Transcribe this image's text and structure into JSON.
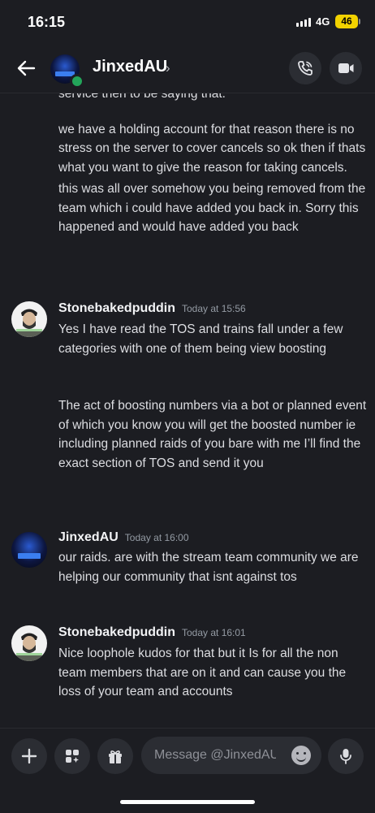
{
  "status": {
    "time": "16:15",
    "network": "4G",
    "battery": "46"
  },
  "header": {
    "title": "JinxedAU",
    "chevron": "›"
  },
  "messages": [
    {
      "lines": [
        "service then to be saying that.",
        "we have a holding account for that reason there is no stress on the server to cover cancels so ok then if thats what you want to give the reason for taking cancels.",
        "this was all over somehow you being removed from the team which i could have added you back in. Sorry this happened and would have added you back"
      ]
    },
    {
      "author": "Stonebakedpuddin",
      "time": "Today at 15:56",
      "lines": [
        "Yes I have read  the TOS and trains fall under a few categories with one of them being view boosting",
        "The act of boosting numbers via a bot or planned event of which you know you will get the boosted number ie including planned raids of you bare with me I’ll find the exact section of TOS and send it you"
      ]
    },
    {
      "author": "JinxedAU",
      "time": "Today at 16:00",
      "lines": [
        "our raids. are with the stream team community we are helping our community that isnt against tos"
      ]
    },
    {
      "author": "Stonebakedpuddin",
      "time": "Today at 16:01",
      "lines": [
        "Nice loophole kudos for that but it Is for all the non team members that are on it and can cause you the loss of your team and accounts"
      ]
    }
  ],
  "composer": {
    "placeholder": "Message @JinxedAU"
  },
  "icons": {
    "back": "arrow-left-icon",
    "call": "phone-icon",
    "video": "video-camera-icon",
    "add": "plus-icon",
    "apps": "apps-icon",
    "gift": "gift-icon",
    "emoji": "smile-icon",
    "mic": "microphone-icon"
  },
  "colors": {
    "background": "#1c1d22",
    "online": "#23a55a",
    "battery": "#f2d200",
    "button": "#2b2d33"
  }
}
